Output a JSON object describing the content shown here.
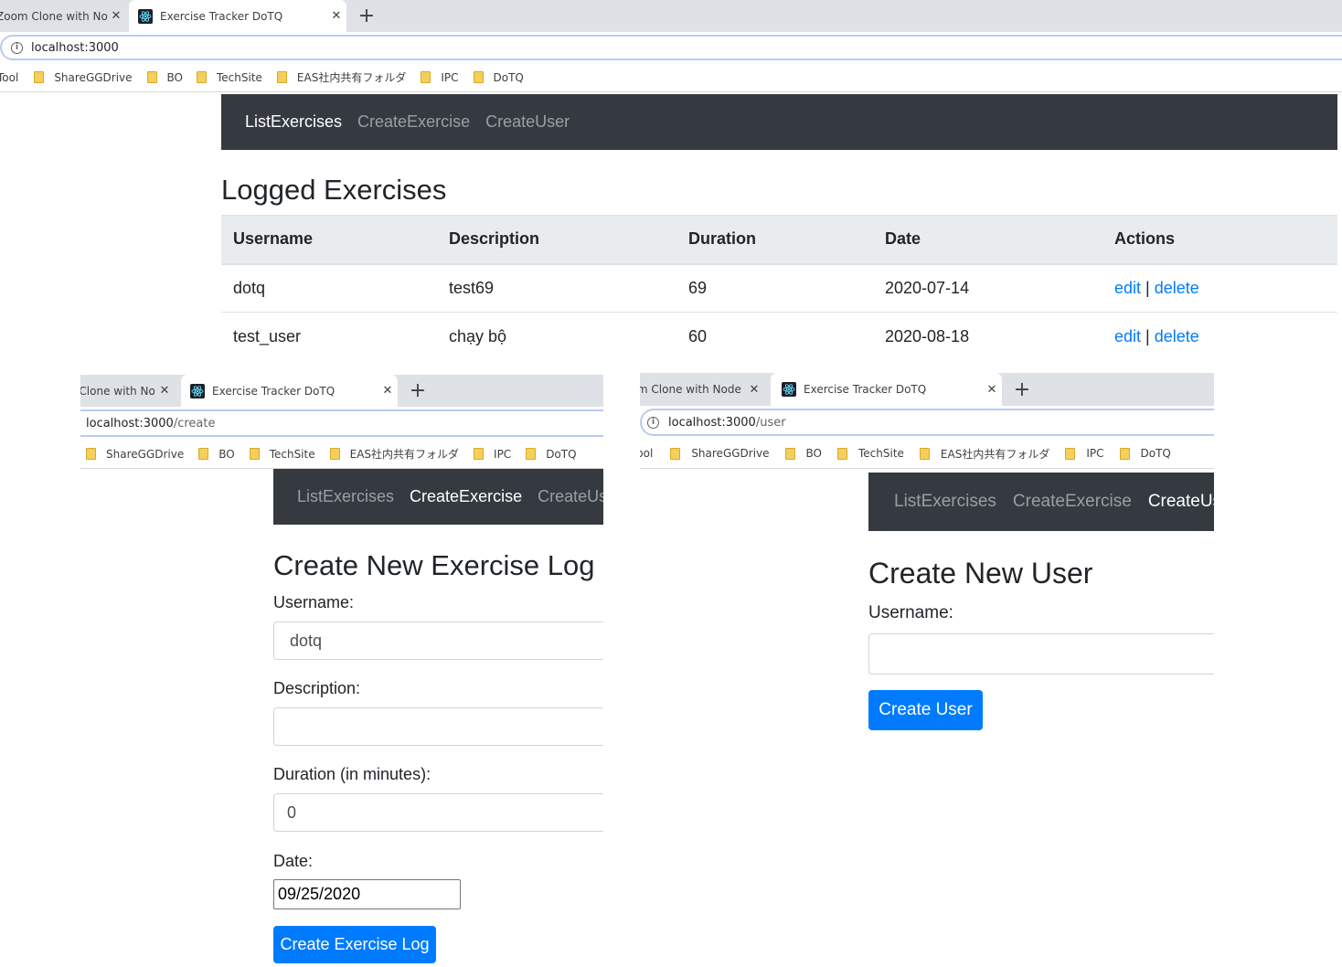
{
  "browser": {
    "inactive_tab_title": "Zoom Clone with Node",
    "active_tab_title": "Exercise Tracker DoTQ",
    "close_glyph": "✕",
    "new_tab_glyph": "+",
    "bookmarks": [
      "Tool",
      "ShareGGDrive",
      "BO",
      "TechSite",
      "EAS社内共有フォルダ",
      "IPC",
      "DoTQ"
    ]
  },
  "navbar": {
    "links": [
      "ListExercises",
      "CreateExercise",
      "CreateUser"
    ]
  },
  "list_page": {
    "url_host": "localhost:3000",
    "url_path": "",
    "heading": "Logged Exercises",
    "columns": [
      "Username",
      "Description",
      "Duration",
      "Date",
      "Actions"
    ],
    "rows": [
      {
        "username": "dotq",
        "description": "test69",
        "duration": "69",
        "date": "2020-07-14"
      },
      {
        "username": "test_user",
        "description": "chạy bộ",
        "duration": "60",
        "date": "2020-08-18"
      }
    ],
    "edit_label": "edit",
    "separator": "|",
    "delete_label": "delete"
  },
  "create_exercise_page": {
    "url_host": "localhost:3000",
    "url_path": "/create",
    "heading": "Create New Exercise Log",
    "username_label": "Username:",
    "username_value": "dotq",
    "description_label": "Description:",
    "description_value": "",
    "duration_label": "Duration (in minutes):",
    "duration_value": "0",
    "date_label": "Date:",
    "date_value": "09/25/2020",
    "submit_label": "Create Exercise Log"
  },
  "create_user_page": {
    "url_host": "localhost:3000",
    "url_path": "/user",
    "heading": "Create New User",
    "username_label": "Username:",
    "username_value": "",
    "submit_label": "Create User"
  },
  "colors": {
    "navbar_bg": "#343a40",
    "primary": "#007bff",
    "table_head_bg": "#e9ecef",
    "tabstrip_bg": "#dee1e6"
  }
}
